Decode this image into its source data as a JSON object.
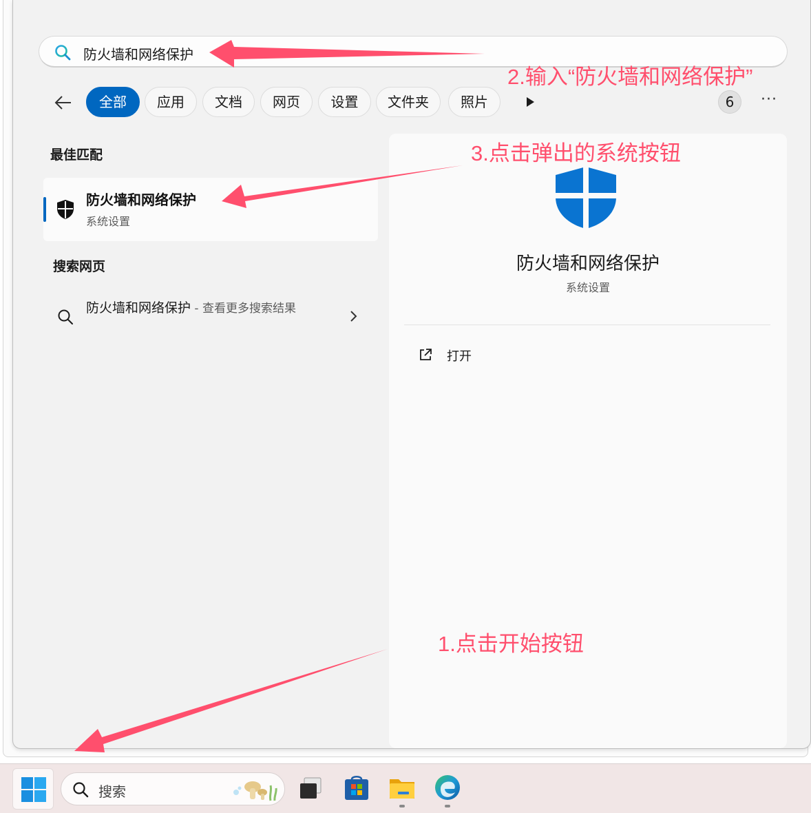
{
  "search": {
    "query": "防火墙和网络保护"
  },
  "filters": {
    "chips": [
      {
        "label": "全部",
        "active": true
      },
      {
        "label": "应用"
      },
      {
        "label": "文档"
      },
      {
        "label": "网页"
      },
      {
        "label": "设置"
      },
      {
        "label": "文件夹"
      },
      {
        "label": "照片"
      }
    ],
    "count": "6",
    "more": "···"
  },
  "left": {
    "best_match_heading": "最佳匹配",
    "best_match": {
      "title": "防火墙和网络保护",
      "subtitle": "系统设置"
    },
    "web_heading": "搜索网页",
    "web_result": {
      "query": "防火墙和网络保护",
      "suffix": " - 查看更多搜索结果"
    }
  },
  "preview": {
    "title": "防火墙和网络保护",
    "subtitle": "系统设置",
    "open_label": "打开"
  },
  "annotations": {
    "step1": "1.点击开始按钮",
    "step2": "2.输入“防火墙和网络保护”",
    "step3": "3.点击弹出的系统按钮"
  },
  "taskbar": {
    "search_placeholder": "搜索"
  },
  "colors": {
    "accent": "#0067c0",
    "annotation": "#ff4f6d",
    "shield_blue": "#0a74d1"
  }
}
